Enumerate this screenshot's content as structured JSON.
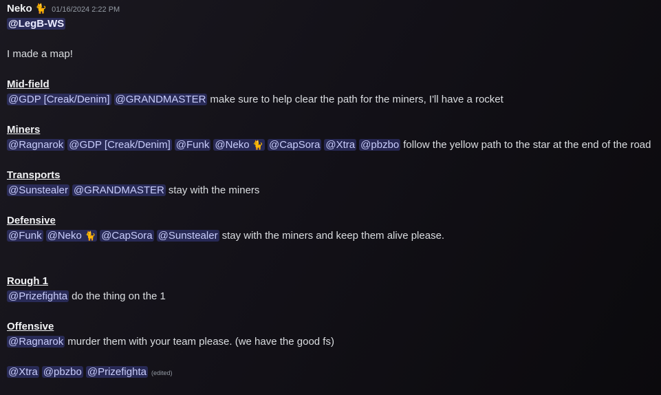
{
  "message": {
    "author": "Neko",
    "author_emoji": "🐈",
    "timestamp": "01/16/2024 2:22 PM",
    "top_mention": "@LegB-WS",
    "intro": "I made a map!",
    "edited_label": "(edited)",
    "sections": {
      "midfield": {
        "heading": "Mid-field",
        "mentions": [
          "@GDP [Creak/Denim]",
          "@GRANDMASTER"
        ],
        "text": "make sure to help clear the path for the miners, I'll have a rocket"
      },
      "miners": {
        "heading": "Miners",
        "mentions": [
          "@Ragnarok",
          "@GDP [Creak/Denim]",
          "@Funk",
          "@Neko",
          "@CapSora",
          "@Xtra",
          "@pbzbo"
        ],
        "text": "follow the yellow path to the star at the end of the road"
      },
      "transports": {
        "heading": "Transports",
        "mentions": [
          "@Sunstealer",
          "@GRANDMASTER"
        ],
        "text": "stay with the miners"
      },
      "defensive": {
        "heading": "Defensive",
        "mentions": [
          "@Funk",
          "@Neko",
          "@CapSora",
          "@Sunstealer"
        ],
        "text": "stay with the miners and keep them alive please."
      },
      "rough1": {
        "heading": "Rough 1",
        "mentions": [
          "@Prizefighta"
        ],
        "text": "do the thing on the 1"
      },
      "offensive": {
        "heading": "Offensive",
        "mentions": [
          "@Ragnarok"
        ],
        "text": "murder them with your team please. (we have the good fs)"
      },
      "final": {
        "mentions": [
          "@Xtra",
          "@pbzbo",
          "@Prizefighta"
        ]
      }
    }
  }
}
